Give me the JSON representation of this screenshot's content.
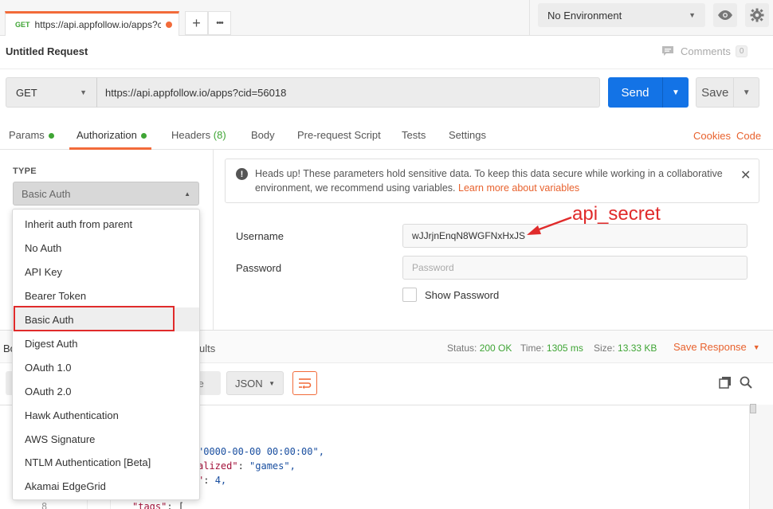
{
  "tab": {
    "method": "GET",
    "url_short": "https://api.appfollow.io/apps?ci...",
    "add_label": "+",
    "more_label": "•••"
  },
  "environment": {
    "selected": "No Environment"
  },
  "request": {
    "title": "Untitled Request",
    "comments_label": "Comments",
    "comments_count": "0",
    "method": "GET",
    "url": "https://api.appfollow.io/apps?cid=56018",
    "send_label": "Send",
    "save_label": "Save"
  },
  "subtabs": {
    "params": "Params",
    "authorization": "Authorization",
    "headers": "Headers",
    "headers_count": "(8)",
    "body": "Body",
    "prerequest": "Pre-request Script",
    "tests": "Tests",
    "settings": "Settings",
    "cookies": "Cookies",
    "code": "Code"
  },
  "auth": {
    "type_label": "TYPE",
    "selected_type": "Basic Auth",
    "menu": [
      "Inherit auth from parent",
      "No Auth",
      "API Key",
      "Bearer Token",
      "Basic Auth",
      "Digest Auth",
      "OAuth 1.0",
      "OAuth 2.0",
      "Hawk Authentication",
      "AWS Signature",
      "NTLM Authentication [Beta]",
      "Akamai EdgeGrid"
    ],
    "alert_text": "Heads up! These parameters hold sensitive data. To keep this data secure while working in a collaborative environment, we recommend using variables.",
    "alert_link": "Learn more about variables",
    "username_label": "Username",
    "username_value": "wJJrjnEnqN8WGFNxHxJS",
    "password_label": "Password",
    "password_placeholder": "Password",
    "show_password_label": "Show Password"
  },
  "annotation": {
    "text": "api_secret",
    "color": "#e02b2b"
  },
  "response": {
    "tab_partial_left": "Bo",
    "tab_partial_right": "ults",
    "status_label": "Status:",
    "status_value": "200 OK",
    "time_label": "Time:",
    "time_value": "1305 ms",
    "size_label": "Size:",
    "size_value": "13.33 KB",
    "save_response": "Save Response",
    "ghost_partial": "te",
    "format": "JSON",
    "code_lines": {
      "l1_str": "\"0000-00-00 00:00:00\",",
      "l2_key": "alized\"",
      "l2_colon": ": ",
      "l2_val": "\"games\",",
      "l3_key": "\"",
      "l3_colon": ": ",
      "l3_val": "4,",
      "l4_num": "8",
      "l4_key": "\"tags\"",
      "l4_rest": ": ["
    }
  },
  "colors": {
    "accent": "#f26b3a",
    "send_blue": "#1373e6",
    "green": "#3fa535",
    "highlight_red": "#e02b2b"
  }
}
